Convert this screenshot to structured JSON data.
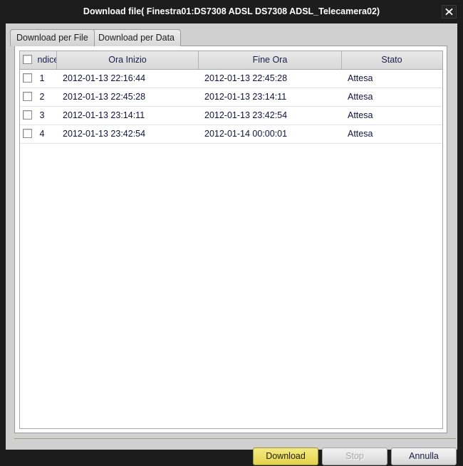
{
  "window": {
    "title": "Download file( Finestra01:DS7308 ADSL DS7308 ADSL_Telecamera02)",
    "close_icon": "close-icon",
    "frame_color": "#1c1c1c",
    "titlebar_color": "#1d1d1d",
    "body_color": "#d0d0d0"
  },
  "tabs": [
    {
      "label": "Download per File",
      "state": "inactive"
    },
    {
      "label": "Download per Data",
      "state": "active"
    }
  ],
  "table": {
    "select_all_checkbox": {
      "checked": false,
      "icon": "checkbox-unchecked-icon"
    },
    "headers": [
      {
        "key": "indice",
        "label": "ndice"
      },
      {
        "key": "ora_inizio",
        "label": "Ora Inizio"
      },
      {
        "key": "fine_ora",
        "label": "Fine Ora"
      },
      {
        "key": "stato",
        "label": "Stato"
      }
    ],
    "rows": [
      {
        "checked": false,
        "indice": "1",
        "ora_inizio": "2012-01-13 22:16:44",
        "fine_ora": "2012-01-13 22:45:28",
        "stato": "Attesa"
      },
      {
        "checked": false,
        "indice": "2",
        "ora_inizio": "2012-01-13 22:45:28",
        "fine_ora": "2012-01-13 23:14:11",
        "stato": "Attesa"
      },
      {
        "checked": false,
        "indice": "3",
        "ora_inizio": "2012-01-13 23:14:11",
        "fine_ora": "2012-01-13 23:42:54",
        "stato": "Attesa"
      },
      {
        "checked": false,
        "indice": "4",
        "ora_inizio": "2012-01-13 23:42:54",
        "fine_ora": "2012-01-14 00:00:01",
        "stato": "Attesa"
      }
    ]
  },
  "buttons": {
    "download": {
      "label": "Download",
      "state": "enabled",
      "accent": "#eee06a"
    },
    "stop": {
      "label": "Stop",
      "state": "disabled"
    },
    "cancel": {
      "label": "Annulla",
      "state": "enabled"
    }
  }
}
